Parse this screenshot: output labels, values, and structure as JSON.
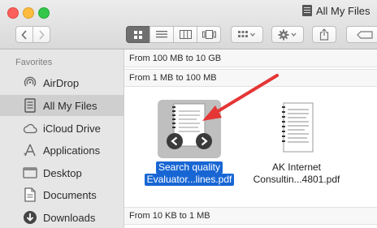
{
  "window": {
    "title": "All My Files",
    "colors": {
      "close": "#fc605c",
      "minimize": "#fdbc40",
      "maximize": "#34c84a",
      "selection": "#1866d4",
      "annotation_arrow": "#e53535"
    }
  },
  "toolbar": {
    "back_icon": "chevron-left-icon",
    "forward_icon": "chevron-right-icon",
    "view_modes": [
      "icon-view",
      "list-view",
      "column-view",
      "cover-flow-view"
    ],
    "arrange_icon": "arrange-grid-icon",
    "action_icon": "gear-icon",
    "share_icon": "share-icon",
    "tag_icon": "tag-icon"
  },
  "sidebar": {
    "heading": "Favorites",
    "items": [
      {
        "label": "AirDrop",
        "icon": "airdrop-icon"
      },
      {
        "label": "All My Files",
        "icon": "all-files-icon",
        "selected": true
      },
      {
        "label": "iCloud Drive",
        "icon": "cloud-icon"
      },
      {
        "label": "Applications",
        "icon": "applications-icon"
      },
      {
        "label": "Desktop",
        "icon": "desktop-icon"
      },
      {
        "label": "Documents",
        "icon": "documents-icon"
      },
      {
        "label": "Downloads",
        "icon": "downloads-icon"
      }
    ]
  },
  "main": {
    "groups": [
      {
        "label": "From 100 MB to 10 GB"
      },
      {
        "label": "From 1 MB to 100 MB"
      },
      {
        "label": "From 10 KB to 1 MB"
      }
    ],
    "files": [
      {
        "line1": "Search quality",
        "line2": "Evaluator...lines.pdf",
        "selected": true
      },
      {
        "line1": "AK Internet",
        "line2": "Consultin...4801.pdf",
        "selected": false
      }
    ]
  }
}
